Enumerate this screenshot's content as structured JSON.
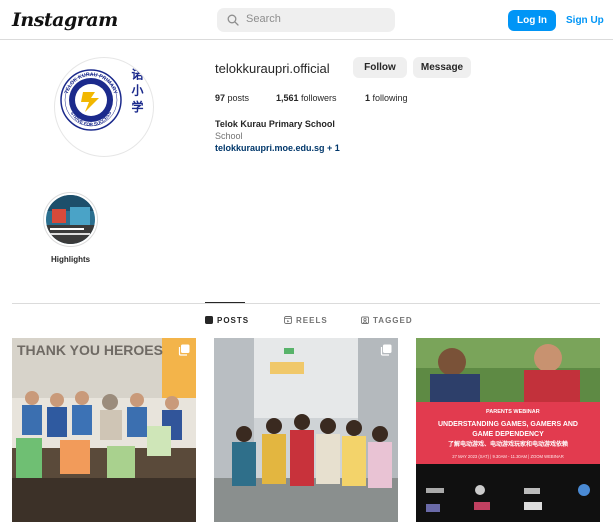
{
  "nav": {
    "logo": "Instagram",
    "search_placeholder": "Search",
    "login_label": "Log In",
    "signup_label": "Sign Up"
  },
  "profile": {
    "username": "telokkuraupri.official",
    "follow_label": "Follow",
    "message_label": "Message",
    "posts_count": "97",
    "posts_word": "posts",
    "followers_count": "1,561",
    "followers_word": "followers",
    "following_count": "1",
    "following_word": "following",
    "full_name": "Telok Kurau Primary School",
    "category": "School",
    "website": "telokkuraupri.moe.edu.sg + 1",
    "logo_ring_text": "TELOK KURAU PRIMARY",
    "logo_motto": "STRIVE FOR SUCCESS",
    "logo_chinese": "友 诺 小 学"
  },
  "highlights": [
    {
      "label": "Highlights"
    }
  ],
  "tabs": [
    {
      "label": "POSTS",
      "icon": "grid-icon",
      "active": true
    },
    {
      "label": "REELS",
      "icon": "reels-icon",
      "active": false
    },
    {
      "label": "TAGGED",
      "icon": "tagged-icon",
      "active": false
    }
  ],
  "posts": [
    {
      "caption_text": "THANK YOU HEROES",
      "multi": true
    },
    {
      "caption_text": "",
      "multi": true
    },
    {
      "multi": false,
      "webinar_head": "PARENTS WEBINAR",
      "webinar_title_1": "UNDERSTANDING GAMES, GAMERS AND",
      "webinar_title_2": "GAME DEPENDENCY",
      "webinar_cn": "了解电动游戏、电动游戏玩家和电动游戏依赖",
      "webinar_date": "27 MAY 2023 (SAT) | 9.30AM - 11.30AM | ZOOM WEBINAR"
    }
  ],
  "colors": {
    "accent": "#0095f6",
    "link": "#00376b",
    "webinar_red": "#e23b4f"
  }
}
